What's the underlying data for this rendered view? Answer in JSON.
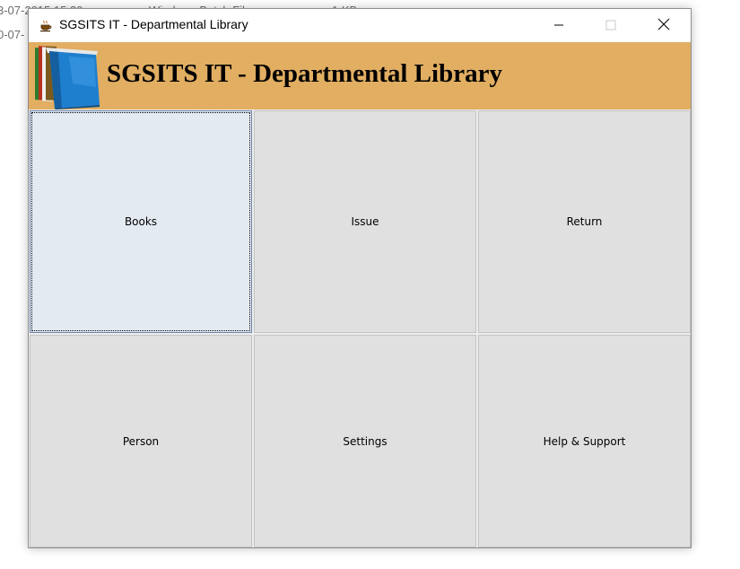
{
  "background": {
    "line1": "3-07-2015 15:30",
    "line1_type": "Windows Batch File",
    "line1_size": "1 KB",
    "line2": "0-07-"
  },
  "window": {
    "title": "SGSITS IT - Departmental Library",
    "controls": {
      "minimize_icon": "minimize-icon",
      "maximize_icon": "maximize-icon",
      "close_icon": "close-icon"
    }
  },
  "header": {
    "title": "SGSITS IT - Departmental Library",
    "color": "#e1ae62"
  },
  "tiles": [
    {
      "label": "Books"
    },
    {
      "label": "Issue"
    },
    {
      "label": "Return"
    },
    {
      "label": "Person"
    },
    {
      "label": "Settings"
    },
    {
      "label": "Help & Support"
    }
  ]
}
